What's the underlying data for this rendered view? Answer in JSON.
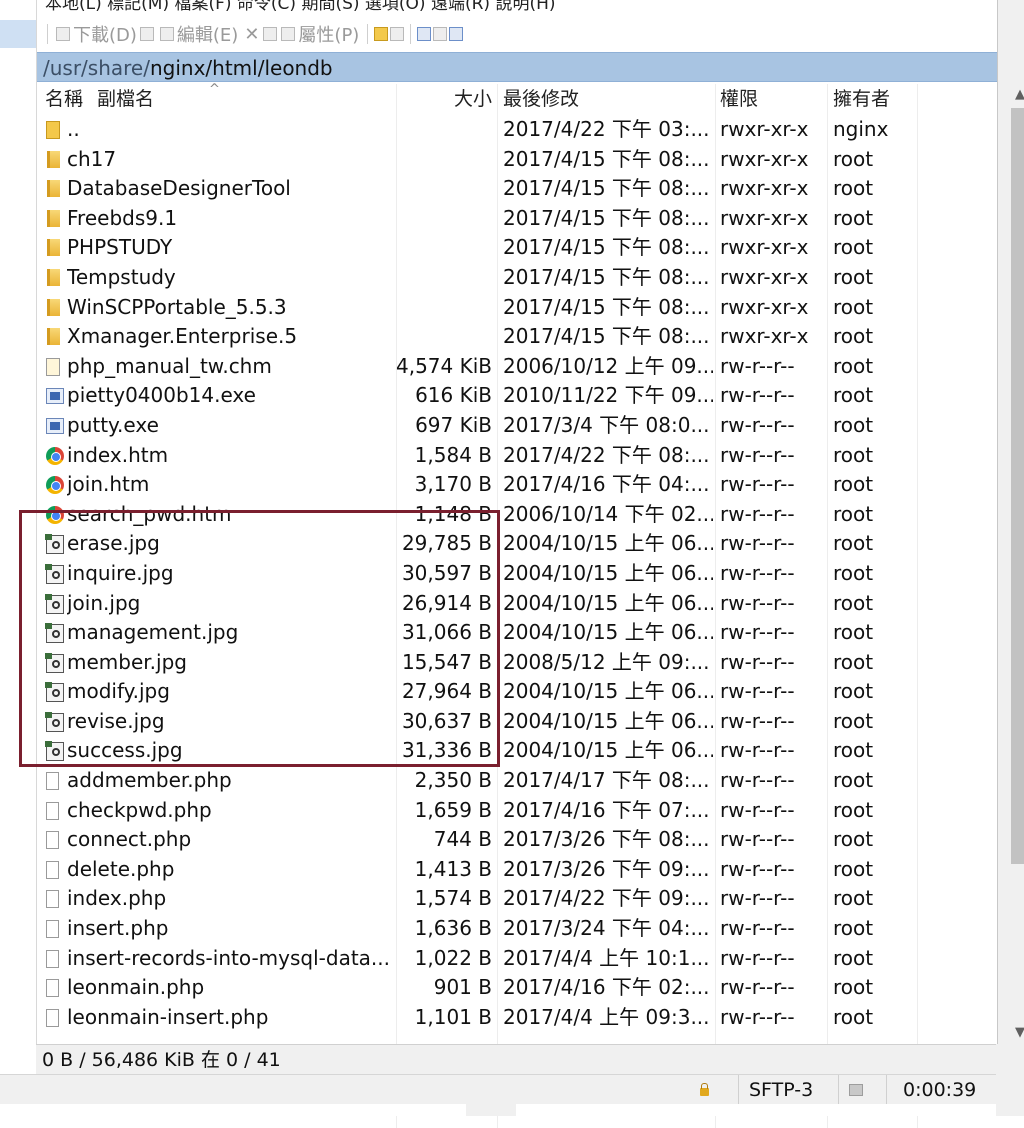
{
  "menubar": {
    "text": "本地(L)  標記(M)  檔案(F)  命令(C)  期間(S)  選項(O)  遠端(R)  說明(H)"
  },
  "toolbar": {
    "download": "下載(D)",
    "edit": "編輯(E)",
    "delete_glyph": "✕",
    "properties": "屬性(P)"
  },
  "path": {
    "prefix": "/usr/share/",
    "rest": "nginx/html/leondb"
  },
  "columns": {
    "name": "名稱",
    "ext": "副檔名",
    "size": "大小",
    "modified": "最後修改",
    "perms": "權限",
    "owner": "擁有者",
    "sort_caret": "^"
  },
  "files": [
    {
      "name": "..",
      "size": "",
      "modified": "2017/4/22 下午 03:...",
      "perms": "rwxr-xr-x",
      "owner": "nginx",
      "icon": "parent-dir-icon"
    },
    {
      "name": "ch17",
      "size": "",
      "modified": "2017/4/15 下午 08:...",
      "perms": "rwxr-xr-x",
      "owner": "root",
      "icon": "folder-icon"
    },
    {
      "name": "DatabaseDesignerTool",
      "size": "",
      "modified": "2017/4/15 下午 08:...",
      "perms": "rwxr-xr-x",
      "owner": "root",
      "icon": "folder-icon"
    },
    {
      "name": "Freebds9.1",
      "size": "",
      "modified": "2017/4/15 下午 08:...",
      "perms": "rwxr-xr-x",
      "owner": "root",
      "icon": "folder-icon"
    },
    {
      "name": "PHPSTUDY",
      "size": "",
      "modified": "2017/4/15 下午 08:...",
      "perms": "rwxr-xr-x",
      "owner": "root",
      "icon": "folder-icon"
    },
    {
      "name": "Tempstudy",
      "size": "",
      "modified": "2017/4/15 下午 08:...",
      "perms": "rwxr-xr-x",
      "owner": "root",
      "icon": "folder-icon"
    },
    {
      "name": "WinSCPPortable_5.5.3",
      "size": "",
      "modified": "2017/4/15 下午 08:...",
      "perms": "rwxr-xr-x",
      "owner": "root",
      "icon": "folder-icon"
    },
    {
      "name": "Xmanager.Enterprise.5",
      "size": "",
      "modified": "2017/4/15 下午 08:...",
      "perms": "rwxr-xr-x",
      "owner": "root",
      "icon": "folder-icon"
    },
    {
      "name": "php_manual_tw.chm",
      "size": "4,574 KiB",
      "modified": "2006/10/12 上午 09...",
      "perms": "rw-r--r--",
      "owner": "root",
      "icon": "chm-file-icon"
    },
    {
      "name": "pietty0400b14.exe",
      "size": "616 KiB",
      "modified": "2010/11/22 下午 09...",
      "perms": "rw-r--r--",
      "owner": "root",
      "icon": "exe-file-icon"
    },
    {
      "name": "putty.exe",
      "size": "697 KiB",
      "modified": "2017/3/4 下午 08:0...",
      "perms": "rw-r--r--",
      "owner": "root",
      "icon": "exe-file-icon"
    },
    {
      "name": "index.htm",
      "size": "1,584 B",
      "modified": "2017/4/22 下午 08:...",
      "perms": "rw-r--r--",
      "owner": "root",
      "icon": "chrome-html-icon"
    },
    {
      "name": "join.htm",
      "size": "3,170 B",
      "modified": "2017/4/16 下午 04:...",
      "perms": "rw-r--r--",
      "owner": "root",
      "icon": "chrome-html-icon"
    },
    {
      "name": "search_pwd.htm",
      "size": "1,148 B",
      "modified": "2006/10/14 下午 02...",
      "perms": "rw-r--r--",
      "owner": "root",
      "icon": "chrome-html-icon"
    },
    {
      "name": "erase.jpg",
      "size": "29,785 B",
      "modified": "2004/10/15 上午 06...",
      "perms": "rw-r--r--",
      "owner": "root",
      "icon": "jpg-file-icon"
    },
    {
      "name": "inquire.jpg",
      "size": "30,597 B",
      "modified": "2004/10/15 上午 06...",
      "perms": "rw-r--r--",
      "owner": "root",
      "icon": "jpg-file-icon"
    },
    {
      "name": "join.jpg",
      "size": "26,914 B",
      "modified": "2004/10/15 上午 06...",
      "perms": "rw-r--r--",
      "owner": "root",
      "icon": "jpg-file-icon"
    },
    {
      "name": "management.jpg",
      "size": "31,066 B",
      "modified": "2004/10/15 上午 06...",
      "perms": "rw-r--r--",
      "owner": "root",
      "icon": "jpg-file-icon"
    },
    {
      "name": "member.jpg",
      "size": "15,547 B",
      "modified": "2008/5/12 上午 09:...",
      "perms": "rw-r--r--",
      "owner": "root",
      "icon": "jpg-file-icon"
    },
    {
      "name": "modify.jpg",
      "size": "27,964 B",
      "modified": "2004/10/15 上午 06...",
      "perms": "rw-r--r--",
      "owner": "root",
      "icon": "jpg-file-icon"
    },
    {
      "name": "revise.jpg",
      "size": "30,637 B",
      "modified": "2004/10/15 上午 06...",
      "perms": "rw-r--r--",
      "owner": "root",
      "icon": "jpg-file-icon"
    },
    {
      "name": "success.jpg",
      "size": "31,336 B",
      "modified": "2004/10/15 上午 06...",
      "perms": "rw-r--r--",
      "owner": "root",
      "icon": "jpg-file-icon"
    },
    {
      "name": "addmember.php",
      "size": "2,350 B",
      "modified": "2017/4/17 下午 08:...",
      "perms": "rw-r--r--",
      "owner": "root",
      "icon": "file-icon"
    },
    {
      "name": "checkpwd.php",
      "size": "1,659 B",
      "modified": "2017/4/16 下午 07:...",
      "perms": "rw-r--r--",
      "owner": "root",
      "icon": "file-icon"
    },
    {
      "name": "connect.php",
      "size": "744 B",
      "modified": "2017/3/26 下午 08:...",
      "perms": "rw-r--r--",
      "owner": "root",
      "icon": "file-icon"
    },
    {
      "name": "delete.php",
      "size": "1,413 B",
      "modified": "2017/3/26 下午 09:...",
      "perms": "rw-r--r--",
      "owner": "root",
      "icon": "file-icon"
    },
    {
      "name": "index.php",
      "size": "1,574 B",
      "modified": "2017/4/22 下午 09:...",
      "perms": "rw-r--r--",
      "owner": "root",
      "icon": "file-icon"
    },
    {
      "name": "insert.php",
      "size": "1,636 B",
      "modified": "2017/3/24 下午 04:...",
      "perms": "rw-r--r--",
      "owner": "root",
      "icon": "file-icon"
    },
    {
      "name": "insert-records-into-mysql-data...",
      "size": "1,022 B",
      "modified": "2017/4/4 上午 10:1...",
      "perms": "rw-r--r--",
      "owner": "root",
      "icon": "file-icon"
    },
    {
      "name": "leonmain.php",
      "size": "901 B",
      "modified": "2017/4/16 下午 02:...",
      "perms": "rw-r--r--",
      "owner": "root",
      "icon": "file-icon"
    },
    {
      "name": "leonmain-insert.php",
      "size": "1,101 B",
      "modified": "2017/4/4 上午 09:3...",
      "perms": "rw-r--r--",
      "owner": "root",
      "icon": "file-icon"
    }
  ],
  "status": {
    "selection": "0 B / 56,486 KiB 在 0 / 41",
    "protocol": "SFTP-3",
    "elapsed": "0:00:39"
  },
  "colors": {
    "path_bar": "#a8c4e2",
    "highlight_box": "#7a1f2e"
  }
}
